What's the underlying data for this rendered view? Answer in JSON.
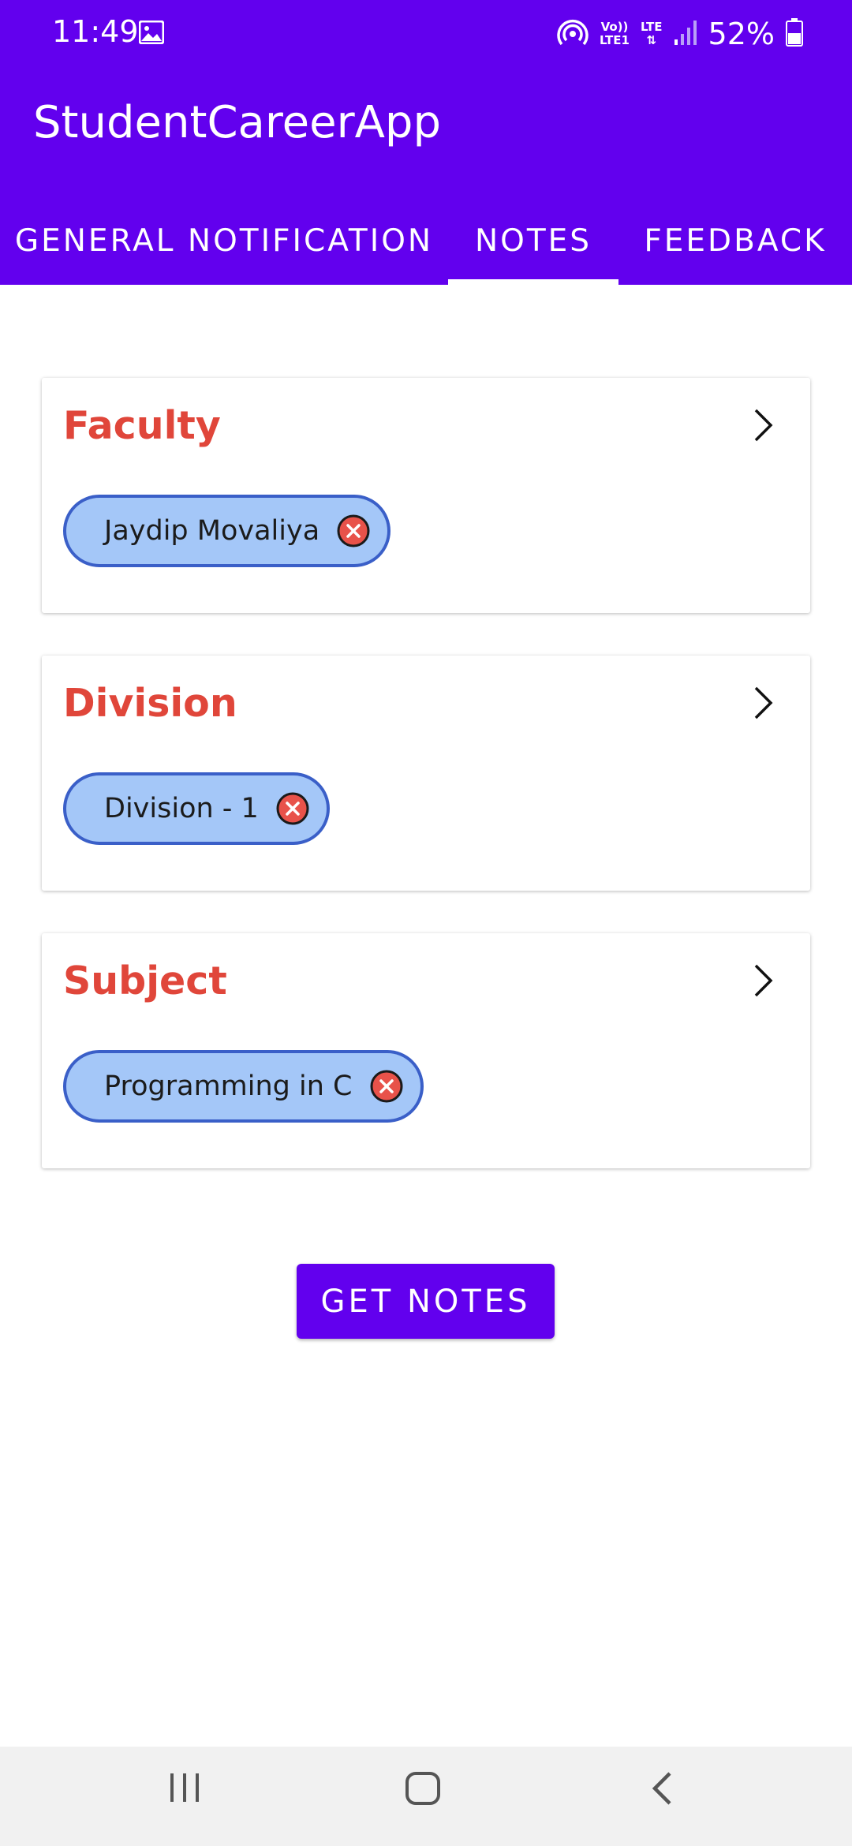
{
  "status_bar": {
    "time": "11:49",
    "volte_label": "Vo))",
    "lte1_label": "LTE1",
    "lte_label": "LTE",
    "battery": "52%",
    "icons": [
      "image-icon",
      "hotspot-icon",
      "signal-icon",
      "battery-icon"
    ]
  },
  "app_bar": {
    "title": "StudentCareerApp",
    "background_color": "#6200ee"
  },
  "tabs": [
    {
      "label": "GENERAL NOTIFICATION",
      "selected": false
    },
    {
      "label": "NOTES",
      "selected": true
    },
    {
      "label": "FEEDBACK",
      "selected": false
    }
  ],
  "filters": [
    {
      "title": "Faculty",
      "chip": "Jaydip Movaliya",
      "icon": "chevron-right-icon"
    },
    {
      "title": "Division",
      "chip": "Division - 1",
      "icon": "chevron-right-icon"
    },
    {
      "title": "Subject",
      "chip": "Programming in C",
      "icon": "chevron-right-icon"
    }
  ],
  "colors": {
    "accent": "#6200ee",
    "filter_title": "#e0463a",
    "chip_fill": "#a4c7f8",
    "chip_border": "#3a5fc8",
    "chip_close": "#e8524a"
  },
  "actions": {
    "get_notes_label": "GET NOTES"
  },
  "nav_bar": {
    "buttons": [
      "recents-icon",
      "home-icon",
      "back-icon"
    ]
  }
}
